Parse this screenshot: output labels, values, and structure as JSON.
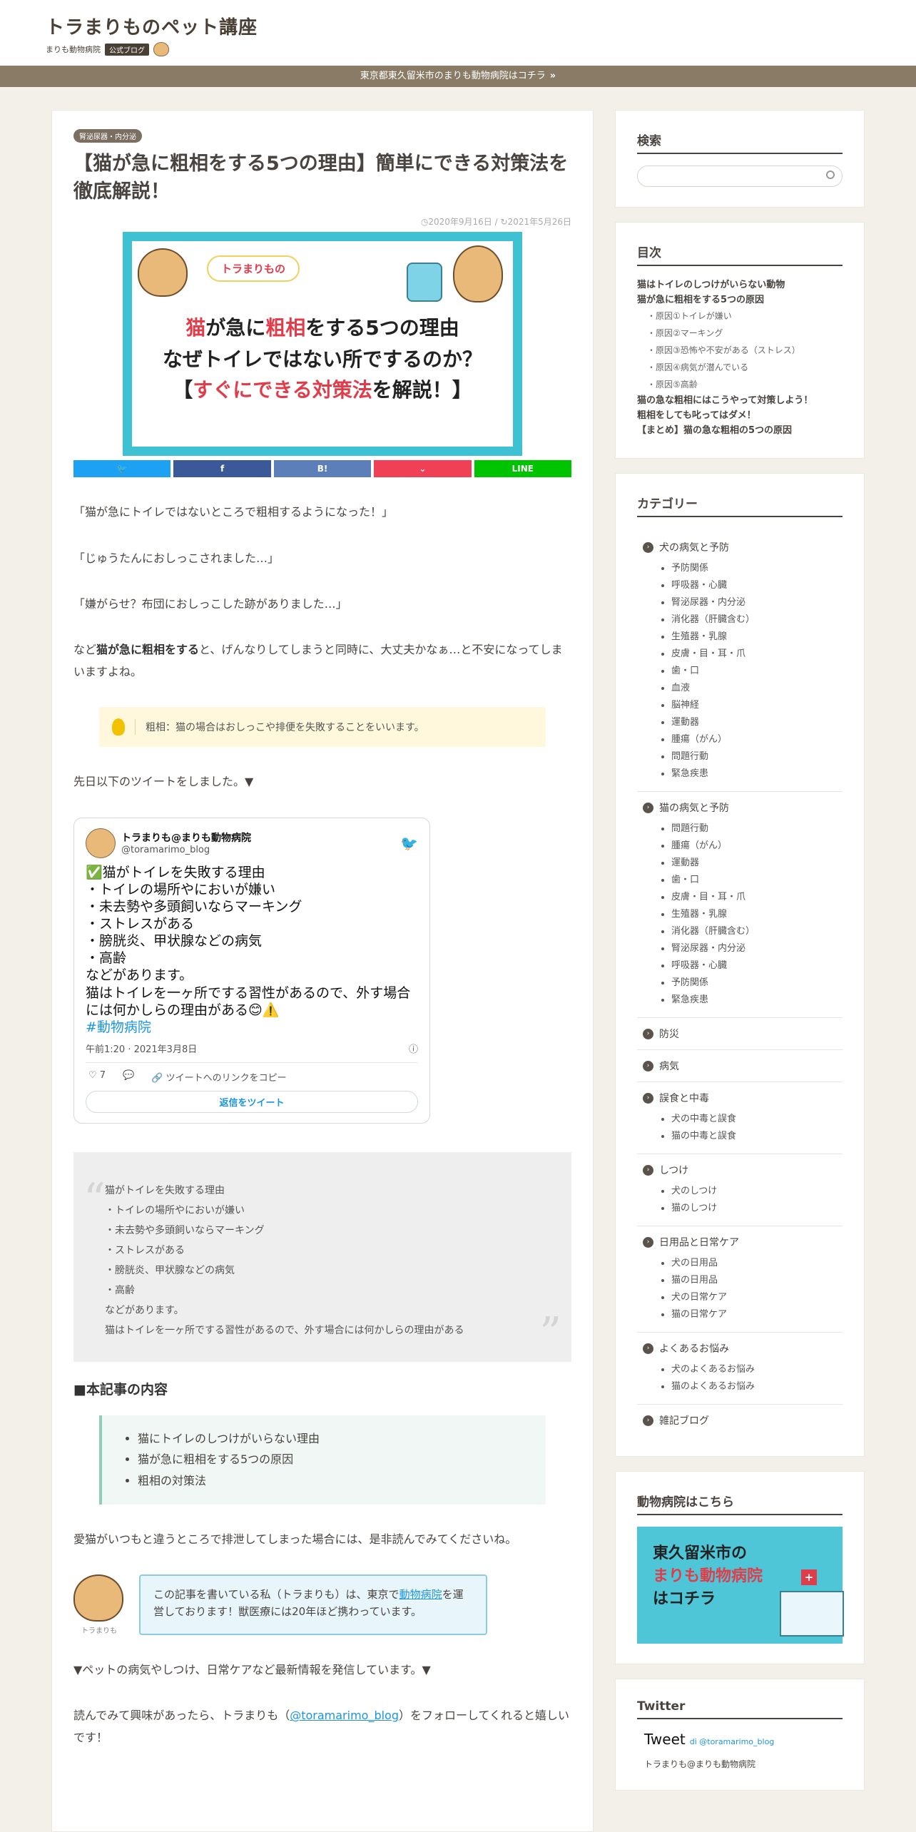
{
  "header": {
    "logo_title": "トラまりものペット講座",
    "logo_sub": "まりも動物病院",
    "logo_tag": "公式ブログ",
    "notice": "東京都東久留米市のまりも動物病院はコチラ",
    "notice_arrow": "»"
  },
  "article": {
    "category": "腎泌尿器・内分泌",
    "title": "【猫が急に粗相をする5つの理由】簡単にできる対策法を徹底解説！",
    "date_published": "2020年9月16日",
    "date_updated": "2021年5月26日",
    "hero": {
      "bubble": "トラまりもの",
      "line1_a": "猫",
      "line1_b": "が急に",
      "line1_c": "粗相",
      "line1_d": "をする5つの理由",
      "line2": "なぜトイレではない所でするのか？",
      "line3_a": "【",
      "line3_b": "すぐにできる対策法",
      "line3_c": "を解説！】"
    },
    "share": {
      "twitter": "🐦",
      "facebook": "f",
      "hatena": "B!",
      "pocket": "⌄",
      "line": "LINE"
    },
    "quote1": "「猫が急にトイレではないところで粗相するようになった！」",
    "quote2": "「じゅうたんにおしっこされました…」",
    "quote3": "「嫌がらせ？布団におしっこした跡がありました…」",
    "para1_a": "など",
    "para1_bold": "猫が急に粗相をする",
    "para1_b": "と、げんなりしてしまうと同時に、大丈夫かなぁ…と不安になってしまいますよね。",
    "memo": "粗相：猫の場合はおしっこや排便を失敗することをいいます。",
    "tweet_intro": "先日以下のツイートをしました。▼",
    "tweet": {
      "name": "トラまりも@まりも動物病院",
      "handle": "@toramarimo_blog",
      "body": "✅猫がトイレを失敗する理由\n・トイレの場所やにおいが嫌い\n・未去勢や多頭飼いならマーキング\n・ストレスがある\n・膀胱炎、甲状腺などの病気\n・高齢\nなどがあります。\n猫はトイレを一ヶ所でする習性があるので、外す場合には何かしらの理由がある😊⚠️",
      "hashtag": "#動物病院",
      "time": "午前1:20 · 2021年3月8日",
      "likes": "7",
      "copy_link": "ツイートへのリンクをコピー",
      "reply": "返信をツイート"
    },
    "blockquote": "猫がトイレを失敗する理由\n・トイレの場所やにおいが嫌い\n・未去勢や多頭飼いならマーキング\n・ストレスがある\n・膀胱炎、甲状腺などの病気\n・高齢\nなどがあります。\n猫はトイレを一ヶ所でする習性があるので、外す場合には何かしらの理由がある",
    "contents_heading": "■本記事の内容",
    "contents": [
      "猫にトイレのしつけがいらない理由",
      "猫が急に粗相をする5つの原因",
      "粗相の対策法"
    ],
    "para2": "愛猫がいつもと違うところで排泄してしまった場合には、是非読んでみてくださいね。",
    "author_name": "トラまりも",
    "author_text_a": "この記事を書いている私（トラまりも）は、東京で",
    "author_link": "動物病院",
    "author_text_b": "を運営しております！獣医療には20年ほど携わっています。",
    "para3": "▼ペットの病気やしつけ、日常ケアなど最新情報を発信しています。▼",
    "para4_a": "読んでみて興味があったら、トラまりも（",
    "para4_link": "@toramarimo_blog",
    "para4_b": "）をフォローしてくれると嬉しいです！"
  },
  "sidebar": {
    "search_title": "検索",
    "toc_title": "目次",
    "toc": [
      {
        "level": 1,
        "text": "猫はトイレのしつけがいらない動物"
      },
      {
        "level": 1,
        "text": "猫が急に粗相をする5つの原因"
      },
      {
        "level": 2,
        "text": "・原因①トイレが嫌い"
      },
      {
        "level": 2,
        "text": "・原因②マーキング"
      },
      {
        "level": 2,
        "text": "・原因③恐怖や不安がある（ストレス）"
      },
      {
        "level": 2,
        "text": "・原因④病気が潜んでいる"
      },
      {
        "level": 2,
        "text": "・原因⑤高齢"
      },
      {
        "level": 1,
        "text": "猫の急な粗相にはこうやって対策しよう！"
      },
      {
        "level": 1,
        "text": "粗相をしても叱ってはダメ！"
      },
      {
        "level": 1,
        "text": "【まとめ】猫の急な粗相の5つの原因"
      }
    ],
    "category_title": "カテゴリー",
    "categories": [
      {
        "name": "犬の病気と予防",
        "children": [
          "予防関係",
          "呼吸器・心臓",
          "腎泌尿器・内分泌",
          "消化器（肝臓含む）",
          "生殖器・乳腺",
          "皮膚・目・耳・爪",
          "歯・口",
          "血液",
          "脳神経",
          "運動器",
          "腫瘍（がん）",
          "問題行動",
          "緊急疾患"
        ]
      },
      {
        "name": "猫の病気と予防",
        "children": [
          "問題行動",
          "腫瘍（がん）",
          "運動器",
          "歯・口",
          "皮膚・目・耳・爪",
          "生殖器・乳腺",
          "消化器（肝臓含む）",
          "腎泌尿器・内分泌",
          "呼吸器・心臓",
          "予防関係",
          "緊急疾患"
        ]
      },
      {
        "name": "防災",
        "children": []
      },
      {
        "name": "病気",
        "children": []
      },
      {
        "name": "誤食と中毒",
        "children": [
          "犬の中毒と誤食",
          "猫の中毒と誤食"
        ]
      },
      {
        "name": "しつけ",
        "children": [
          "犬のしつけ",
          "猫のしつけ"
        ]
      },
      {
        "name": "日用品と日常ケア",
        "children": [
          "犬の日用品",
          "猫の日用品",
          "犬の日常ケア",
          "猫の日常ケア"
        ]
      },
      {
        "name": "よくあるお悩み",
        "children": [
          "犬のよくあるお悩み",
          "猫のよくあるお悩み"
        ]
      },
      {
        "name": "雑記ブログ",
        "children": []
      }
    ],
    "clinic_title": "動物病院はこちら",
    "clinic_line1": "東久留米市の",
    "clinic_line2": "まりも動物病院",
    "clinic_line3": "はコチラ",
    "clinic_cross": "+",
    "twitter_title": "Twitter",
    "twitter_tweet": "Tweet",
    "twitter_by": "di @toramarimo_blog",
    "twitter_name": "トラまりも@まりも動物病院"
  }
}
